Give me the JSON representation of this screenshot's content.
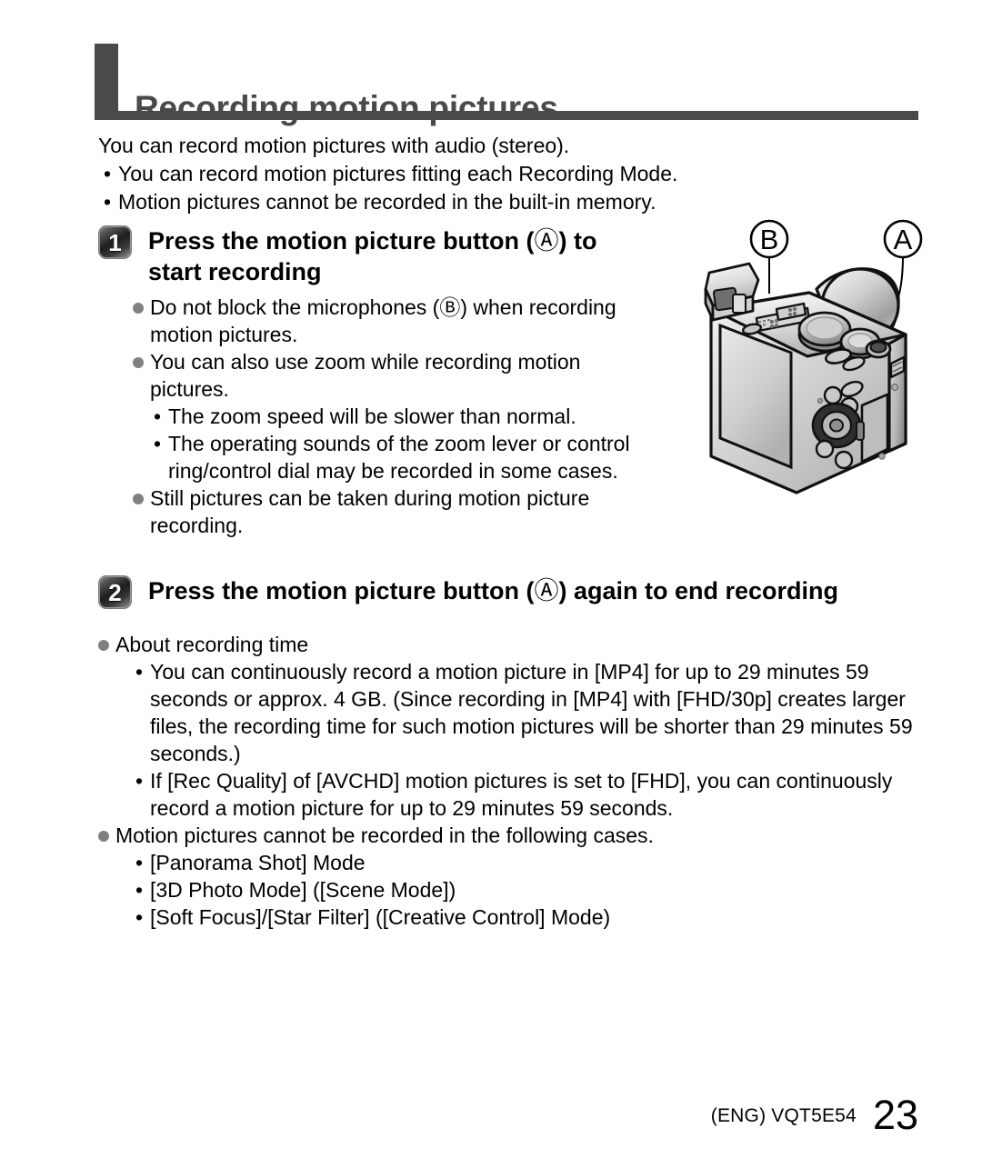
{
  "page": {
    "title": "Recording motion pictures",
    "footer_code": "(ENG) VQT5E54",
    "footer_page": "23"
  },
  "intro": {
    "lead": "You can record motion pictures with audio (stereo).",
    "dash_items": [
      "You can record motion pictures fitting each Recording Mode.",
      "Motion pictures cannot be recorded in the built-in memory."
    ],
    "dash_glyph": "•"
  },
  "step1": {
    "number": "1",
    "title_line1_pre": "Press the motion picture button (",
    "title_circle": "Ⓐ",
    "title_line1_post": ") to",
    "title_line2": "start recording",
    "bullets": [
      {
        "text_pre": "Do not block the microphones (",
        "circle": "Ⓑ",
        "text_post": ") when recording",
        "text_line2": "motion pictures."
      },
      {
        "text_pre": "You can also use zoom while recording motion",
        "text_line2": "pictures.",
        "sub": [
          "The zoom speed will be slower than normal.",
          "The operating sounds of the zoom lever or control ring/control dial may be recorded in some cases."
        ]
      },
      {
        "text_pre": "Still pictures can be taken during motion picture",
        "text_line2": "recording."
      }
    ]
  },
  "step2": {
    "number": "2",
    "title_pre": "Press the motion picture button (",
    "title_circle": "Ⓐ",
    "title_post": ") again to end recording",
    "bullets": [
      {
        "text": "About recording time",
        "sub": [
          "You can continuously record a motion picture in [MP4] for up to 29 minutes 59 seconds or approx. 4 GB. (Since recording in [MP4] with [FHD/30p] creates larger files, the recording time for such motion pictures will be shorter than 29 minutes 59 seconds.)",
          "If [Rec Quality] of [AVCHD] motion pictures is set to [FHD], you can continuously record a motion picture for up to 29 minutes 59 seconds."
        ]
      },
      {
        "text": "Motion pictures cannot be recorded in the following cases.",
        "sub": [
          "[Panorama Shot] Mode",
          "[3D Photo Mode] ([Scene Mode])",
          "[Soft Focus]/[Star Filter] ([Creative Control] Mode)"
        ]
      }
    ]
  },
  "figure": {
    "label_a": "Ⓐ",
    "label_b": "Ⓑ",
    "description": "rear three-quarter view of a compact digital camera"
  },
  "colors": {
    "header_bar": "#4a4a4a",
    "bullet_dot": "#808080",
    "text": "#000000"
  }
}
